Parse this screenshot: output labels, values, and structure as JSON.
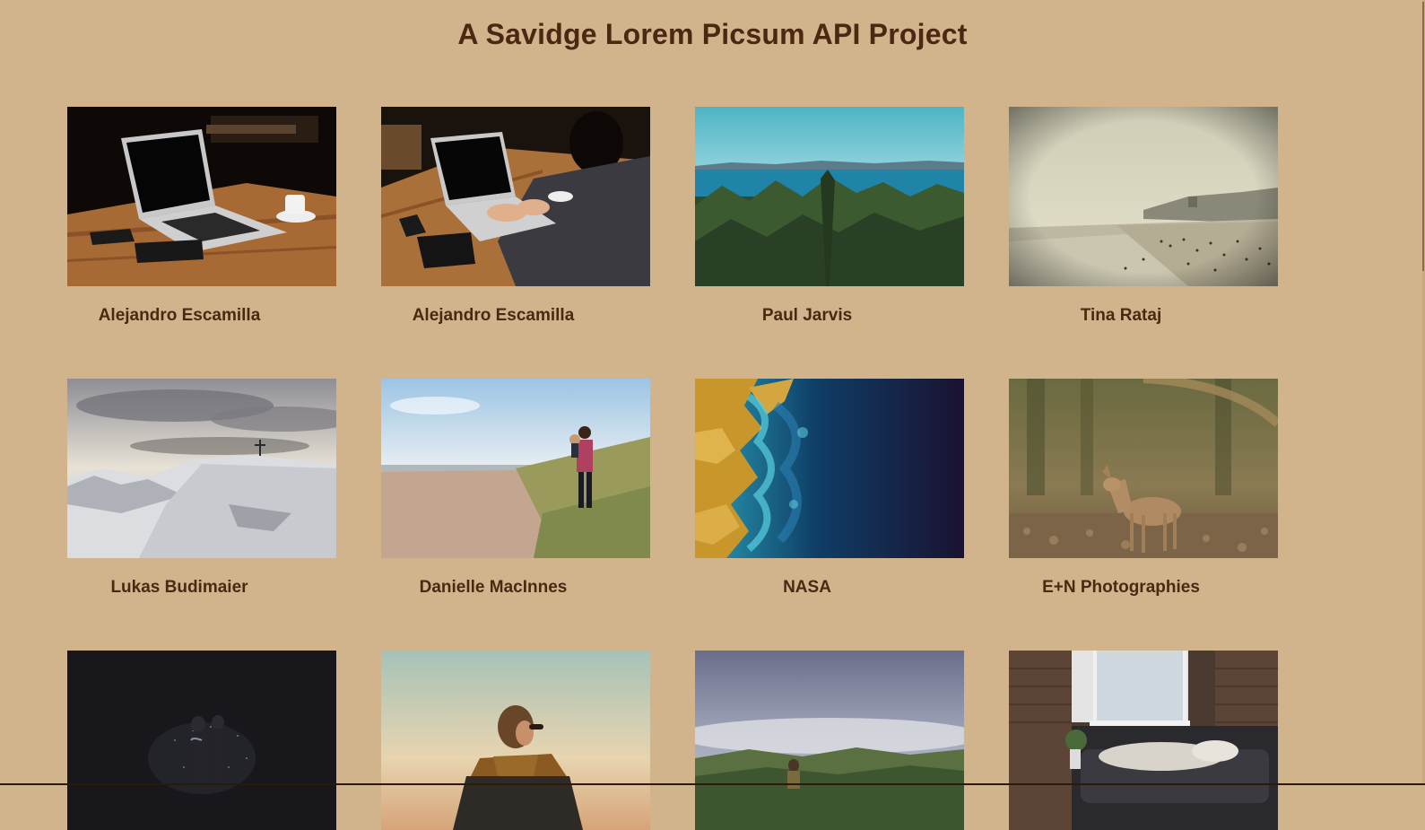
{
  "header": {
    "title": "A Savidge Lorem Picsum API Project"
  },
  "photos": [
    {
      "author": "Alejandro Escamilla",
      "image": "laptop-on-wooden-table"
    },
    {
      "author": "Alejandro Escamilla",
      "image": "person-typing-on-laptop"
    },
    {
      "author": "Paul Jarvis",
      "image": "forest-above-sea"
    },
    {
      "author": "Tina Rataj",
      "image": "crowded-beach"
    },
    {
      "author": "Lukas Budimaier",
      "image": "snowy-summit-with-cross"
    },
    {
      "author": "Danielle MacInnes",
      "image": "father-carrying-child-on-beach"
    },
    {
      "author": "NASA",
      "image": "satellite-coastline"
    },
    {
      "author": "E+N Photographies",
      "image": "fawn-in-forest"
    },
    {
      "author": "",
      "image": "couple-in-night-rain"
    },
    {
      "author": "",
      "image": "woman-in-scarf-at-sunset"
    },
    {
      "author": "",
      "image": "hiker-above-misty-valley"
    },
    {
      "author": "",
      "image": "person-resting-on-sofa"
    }
  ],
  "colors": {
    "background": "#d2b48c",
    "text": "#4b2812"
  }
}
